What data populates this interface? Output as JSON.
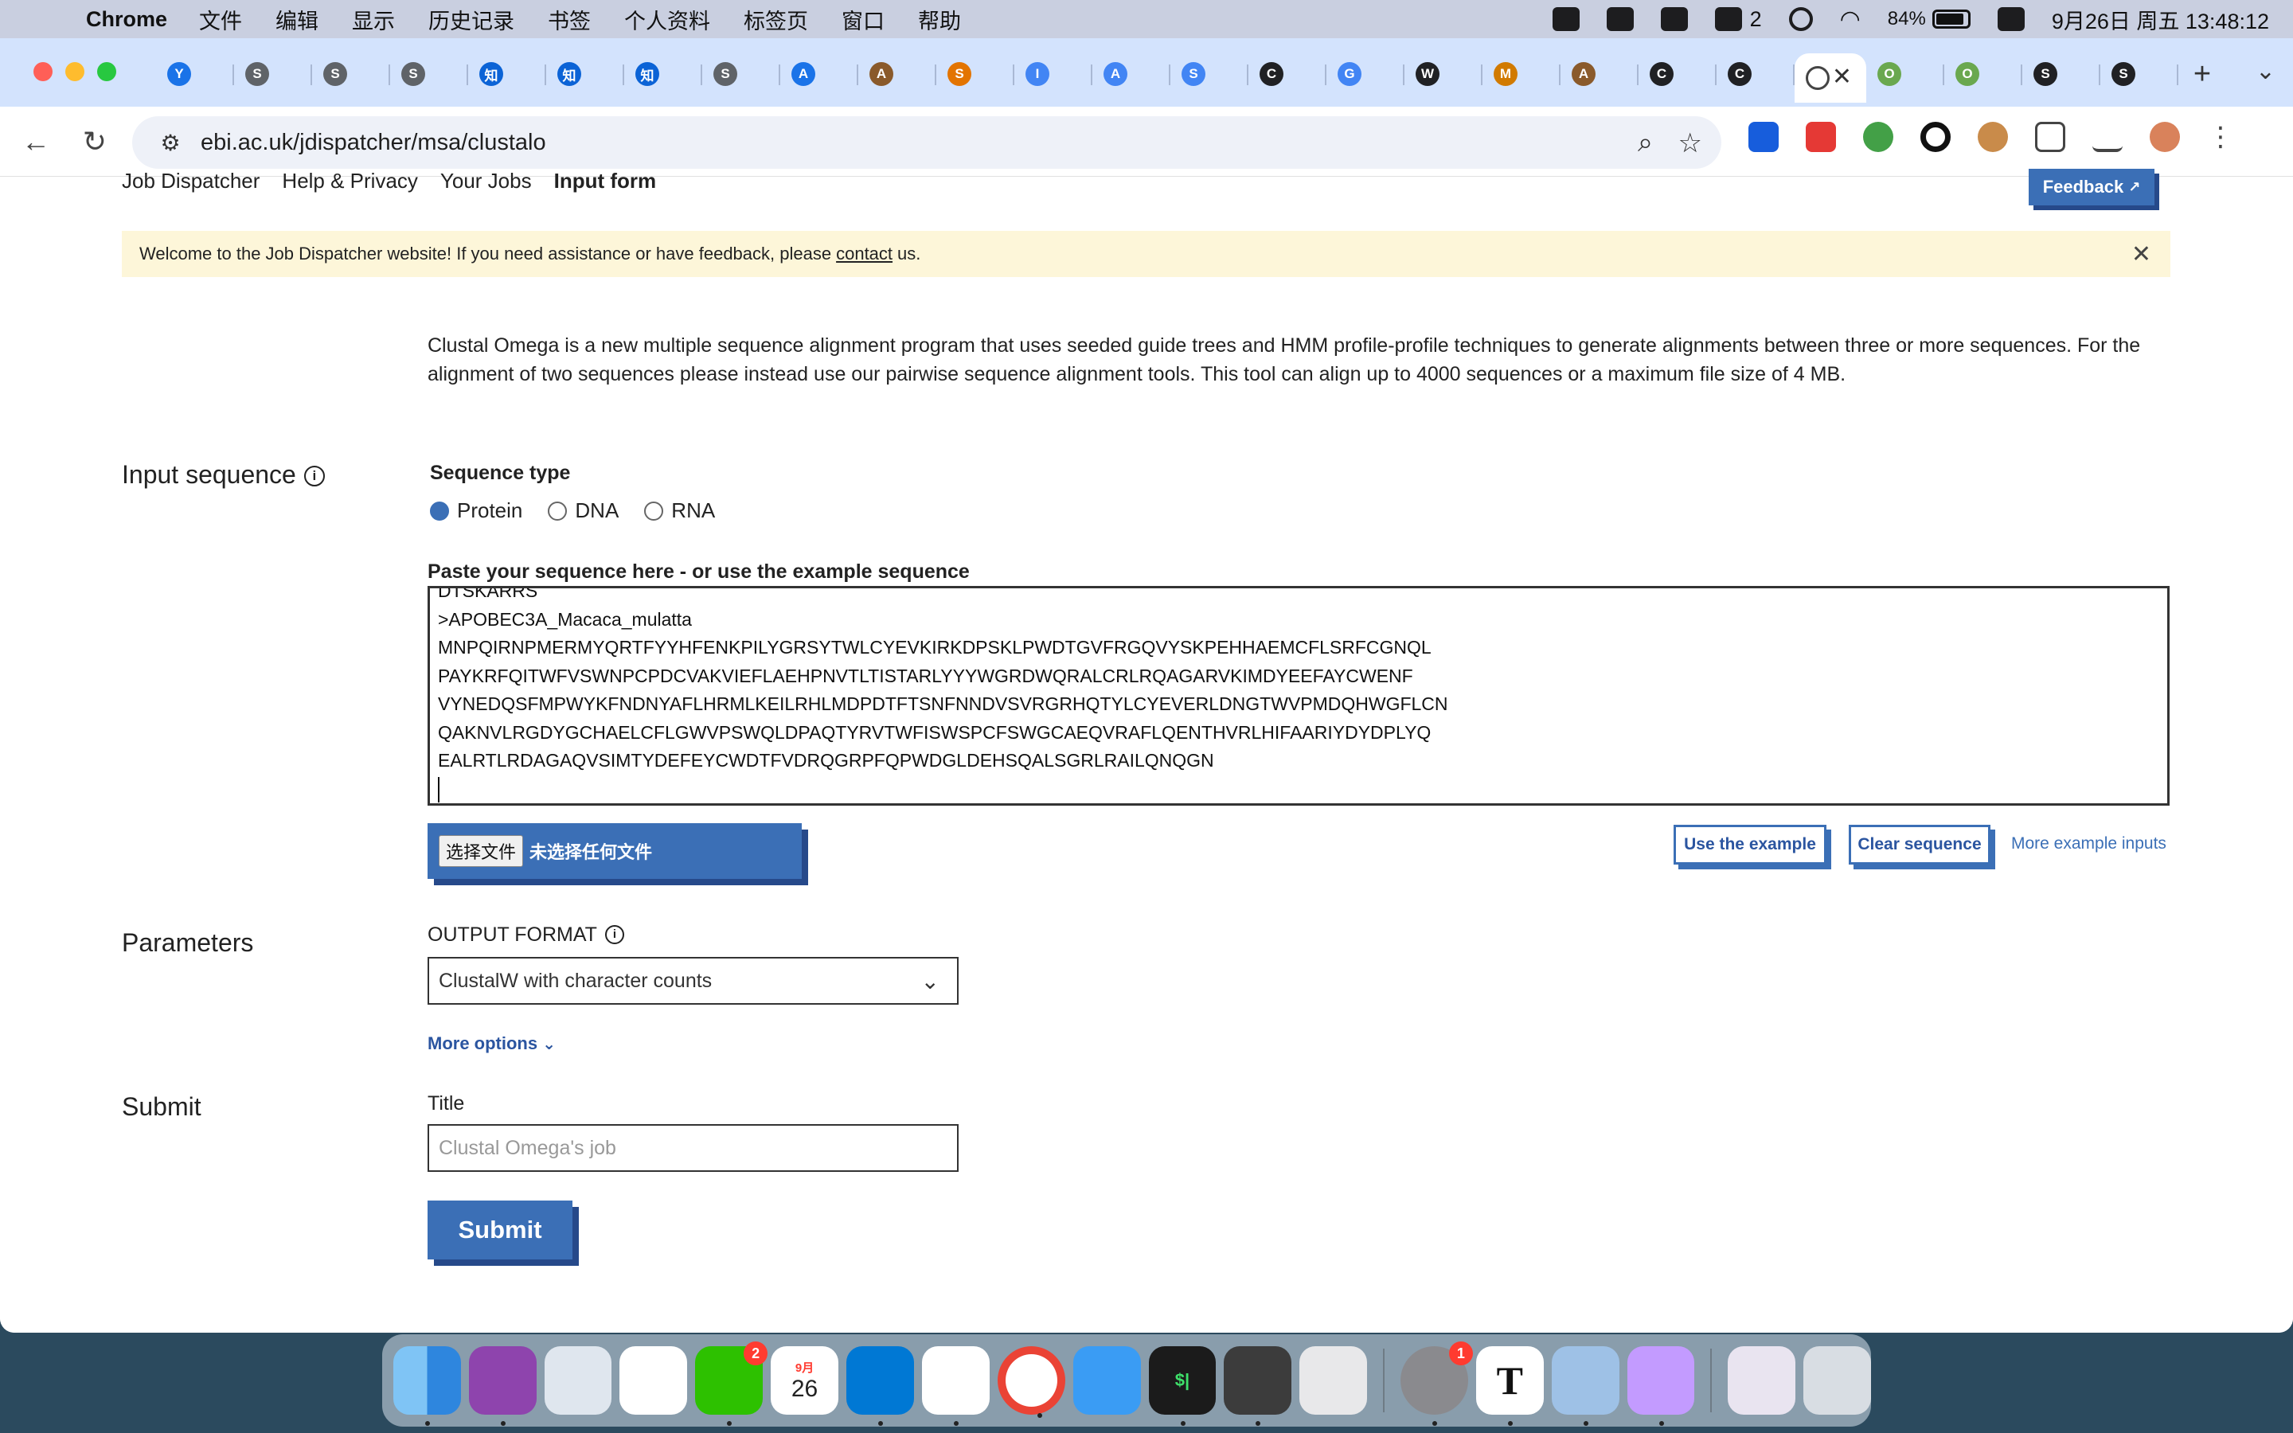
{
  "menubar": {
    "app": "Chrome",
    "items": [
      "文件",
      "编辑",
      "显示",
      "历史记录",
      "书签",
      "个人资料",
      "标签页",
      "窗口",
      "帮助"
    ],
    "wechat_count": "2",
    "battery": "84%",
    "clock": "9月26日 周五 13:48:12"
  },
  "browser": {
    "url": "ebi.ac.uk/jdispatcher/msa/clustalo",
    "tab_favicons": [
      "Y",
      "S",
      "S",
      "S",
      "知",
      "知",
      "知",
      "S",
      "A",
      "A",
      "S",
      "I",
      "A",
      "S",
      "C",
      "G",
      "W",
      "M",
      "A",
      "C",
      "C",
      "O",
      "O",
      "S",
      "S"
    ],
    "active_tab_close": "✕",
    "new_tab": "+"
  },
  "subnav": {
    "items": [
      "Job Dispatcher",
      "Help & Privacy",
      "Your Jobs",
      "Input form"
    ],
    "active": "Input form",
    "feedback": "Feedback"
  },
  "banner": {
    "text_before": "Welcome to the Job Dispatcher website! If you need assistance or have feedback, please",
    "link": "contact",
    "text_after": "us."
  },
  "intro": "Clustal Omega is a new multiple sequence alignment program that uses seeded guide trees and HMM profile-profile techniques to generate alignments between three or more sequences. For the alignment of two sequences please instead use our pairwise sequence alignment tools. This tool can align up to 4000 sequences or a maximum file size of 4 MB.",
  "input_section": {
    "title": "Input sequence",
    "seq_type_label": "Sequence type",
    "seq_types": [
      "Protein",
      "DNA",
      "RNA"
    ],
    "selected_type": "Protein",
    "paste_label": "Paste your sequence here - or use the example sequence",
    "sequence_lines": [
      "DTSKARRS",
      ">APOBEC3A_Macaca_mulatta",
      "MNPQIRNPMERMYQRTFYYHFENKPILYGRSYTWLCYEVKIRKDPSKLPWDTGVFRGQVYSKPEHHAEMCFLSRFCGNQL",
      "PAYKRFQITWFVSWNPCPDCVAKVIEFLAEHPNVTLTISTARLYYYWGRDWQRALCRLRQAGARVKIMDYEEFAYCWENF",
      "VYNEDQSFMPWYKFNDNYAFLHRMLKEILRHLMDPDTFTSNFNNDVSVRGRHQTYLCYEVERLDNGTWVPMDQHWGFLCN",
      "QAKNVLRGDYGCHAELCFLGWVPSWQLDPAQTYRVTWFISWSPCFSWGCAEQVRAFLQENTHVRLHIFAARIYDYDPLYQ",
      "EALRTLRDAGAQVSIMTYDEFEYCWDTFVDRQGRPFQPWDGLDEHSQALSGRLRAILQNQGN"
    ],
    "file_choose": "选择文件",
    "file_none": "未选择任何文件",
    "use_example": "Use the example",
    "clear_sequence": "Clear sequence",
    "more_examples": "More example inputs"
  },
  "parameters": {
    "title": "Parameters",
    "output_format_label": "OUTPUT FORMAT",
    "output_format_value": "ClustalW with character counts",
    "more_options": "More options"
  },
  "submit_section": {
    "title": "Submit",
    "title_label": "Title",
    "title_placeholder": "Clustal Omega's job",
    "submit_label": "Submit"
  },
  "dock": {
    "wechat_badge": "2",
    "calendar_month": "9月",
    "calendar_day": "26",
    "settings_badge": "1"
  },
  "colors": {
    "ebi_blue": "#3b6fb6",
    "ebi_blue_dark": "#26498a",
    "banner_bg": "#fdf6d9",
    "tabstrip": "#d3e3fd"
  }
}
